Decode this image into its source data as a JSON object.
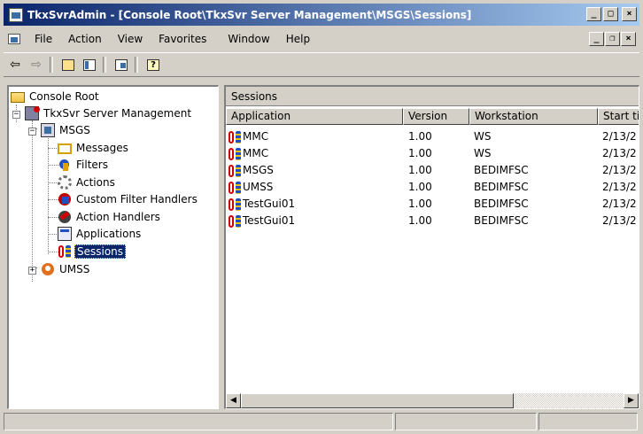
{
  "window": {
    "title": "TkxSvrAdmin - [Console Root\\TkxSvr Server Management\\MSGS\\Sessions]",
    "controls": {
      "minimize": "_",
      "maximize": "□",
      "close": "×"
    }
  },
  "menubar": {
    "items": [
      {
        "label": "File"
      },
      {
        "label": "Action"
      },
      {
        "label": "View"
      },
      {
        "label": "Favorites"
      },
      {
        "label": "Window"
      },
      {
        "label": "Help"
      }
    ],
    "mdi_controls": {
      "minimize": "_",
      "restore": "❐",
      "close": "×"
    }
  },
  "toolbar": {
    "back": "⇦",
    "forward": "⇨",
    "help": "?"
  },
  "tree": {
    "root": "Console Root",
    "server": "TkxSvr Server Management",
    "msgs": "MSGS",
    "messages": "Messages",
    "filters": "Filters",
    "actions": "Actions",
    "custom_filter_handlers": "Custom Filter Handlers",
    "action_handlers": "Action Handlers",
    "applications": "Applications",
    "sessions": "Sessions",
    "umss": "UMSS",
    "expanded_sign": "−",
    "collapsed_sign": "+"
  },
  "list": {
    "pane_title": "Sessions",
    "columns": [
      "Application",
      "Version",
      "Workstation",
      "Start ti"
    ],
    "rows": [
      [
        "MMC",
        "1.00",
        "WS",
        "2/13/2"
      ],
      [
        "MMC",
        "1.00",
        "WS",
        "2/13/2"
      ],
      [
        "MSGS",
        "1.00",
        "BEDIMFSC",
        "2/13/2"
      ],
      [
        "UMSS",
        "1.00",
        "BEDIMFSC",
        "2/13/2"
      ],
      [
        "TestGui01",
        "1.00",
        "BEDIMFSC",
        "2/13/2"
      ],
      [
        "TestGui01",
        "1.00",
        "BEDIMFSC",
        "2/13/2"
      ]
    ],
    "scroll_left": "◀",
    "scroll_right": "▶"
  }
}
